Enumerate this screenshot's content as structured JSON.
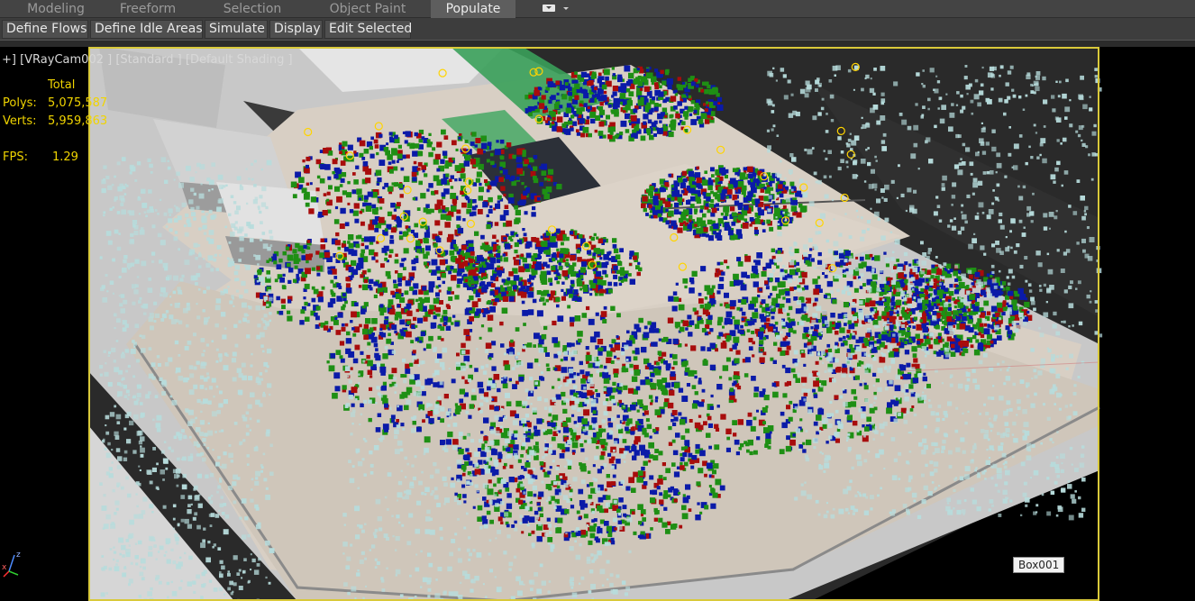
{
  "ribbon": {
    "tabs": [
      {
        "label": "Modeling",
        "active": false
      },
      {
        "label": "Freeform",
        "active": false
      },
      {
        "label": "Selection",
        "active": false
      },
      {
        "label": "Object Paint",
        "active": false
      },
      {
        "label": "Populate",
        "active": true
      }
    ],
    "dropdown_icon": "ribbon-options-icon"
  },
  "toolbar": {
    "buttons": [
      {
        "label": "Define Flows"
      },
      {
        "label": "Define Idle Areas"
      },
      {
        "label": "Simulate"
      },
      {
        "label": "Display"
      },
      {
        "label": "Edit Selected"
      }
    ]
  },
  "viewport": {
    "label": "+] [VRayCam002 ] [Standard ] [Default Shading ]",
    "stats": {
      "header": "Total",
      "polys_label": "Polys:",
      "polys_value": "5,075,587",
      "verts_label": "Verts:",
      "verts_value": "5,959,863",
      "fps_label": "FPS:",
      "fps_value": "1.29"
    },
    "object_label": "Box001",
    "axis": {
      "z": "z",
      "x": "x"
    },
    "colors": {
      "frame": "#d9c93a",
      "stats_text": "#f0d400",
      "ground": "#c9c9c9",
      "pavement": "#d8cfc4",
      "crowd_blue": "#0a1aa8",
      "crowd_green": "#1e8f14",
      "crowd_red": "#a80c0c",
      "trees": "#b7dcdc",
      "waypoint": "#ffd400"
    }
  }
}
